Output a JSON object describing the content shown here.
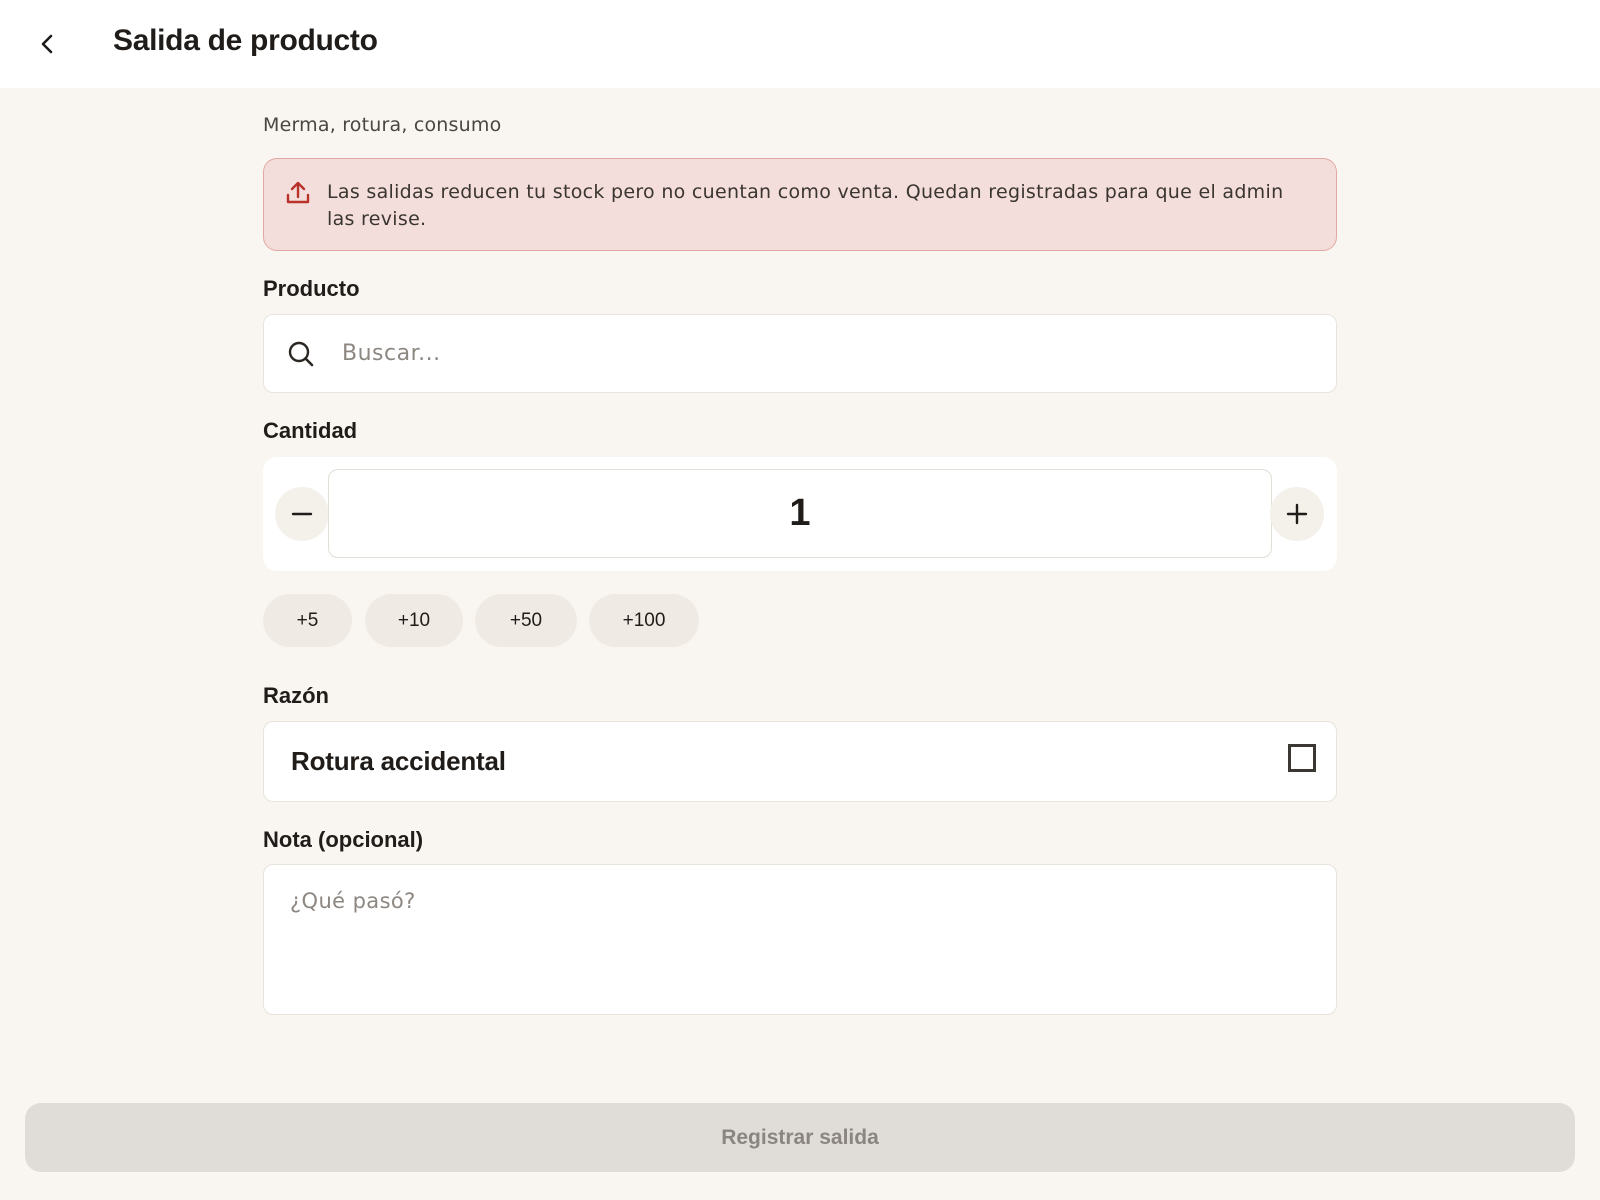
{
  "header": {
    "title": "Salida de producto",
    "back_icon": "chevron-left-icon"
  },
  "subtitle": "Merma, rotura, consumo",
  "alert": {
    "icon": "upload-icon",
    "text": "Las salidas reducen tu stock pero no cuentan como venta. Quedan registradas para que el admin las revise.",
    "color": "#b8322a"
  },
  "product": {
    "label": "Producto",
    "search_placeholder": "Buscar...",
    "search_value": "",
    "icon": "search-icon"
  },
  "quantity": {
    "label": "Cantidad",
    "value": "1",
    "minus_icon": "minus-icon",
    "plus_icon": "plus-icon",
    "quick_adds": [
      "+5",
      "+10",
      "+50",
      "+100"
    ]
  },
  "reason": {
    "label": "Razón",
    "selected": "Rotura accidental"
  },
  "note": {
    "label": "Nota (opcional)",
    "placeholder": "¿Qué pasó?",
    "value": ""
  },
  "submit": {
    "label": "Registrar salida",
    "enabled": false
  }
}
